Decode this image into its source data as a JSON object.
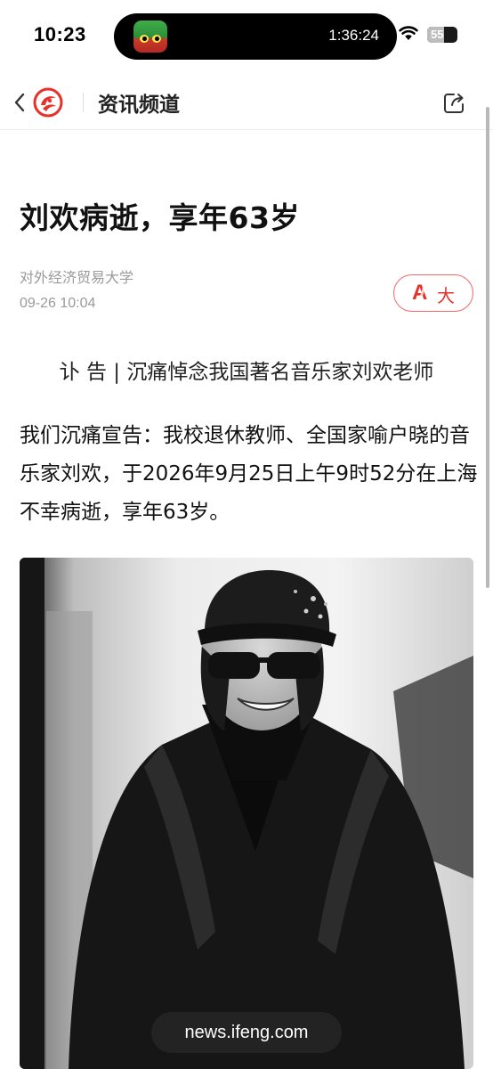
{
  "status_bar": {
    "time": "10:23",
    "island_timer": "1:36:24",
    "battery_level": "55",
    "battery_fraction": 0.55,
    "island_app_icon": "game-app-icon",
    "wifi_icon": "wifi-icon"
  },
  "nav": {
    "title": "资讯频道",
    "back_icon": "chevron-left-icon",
    "logo_icon": "ifeng-logo-icon",
    "share_icon": "share-icon"
  },
  "article": {
    "headline": "刘欢病逝，享年63岁",
    "source": "对外经济贸易大学",
    "date": "09-26 10:04",
    "font_button": {
      "glyph": "A",
      "label": "大"
    },
    "subhead": "讣 告 | 沉痛悼念我国著名音乐家刘欢老师",
    "body": "我们沉痛宣告：我校退休教师、全国家喻户晓的音乐家刘欢，于2026年9月25日上午9时52分在上海不幸病逝，享年63岁。"
  },
  "footer": {
    "url": "news.ifeng.com"
  },
  "colors": {
    "accent": "#e8302a",
    "muted_text": "#9a9a9a"
  }
}
